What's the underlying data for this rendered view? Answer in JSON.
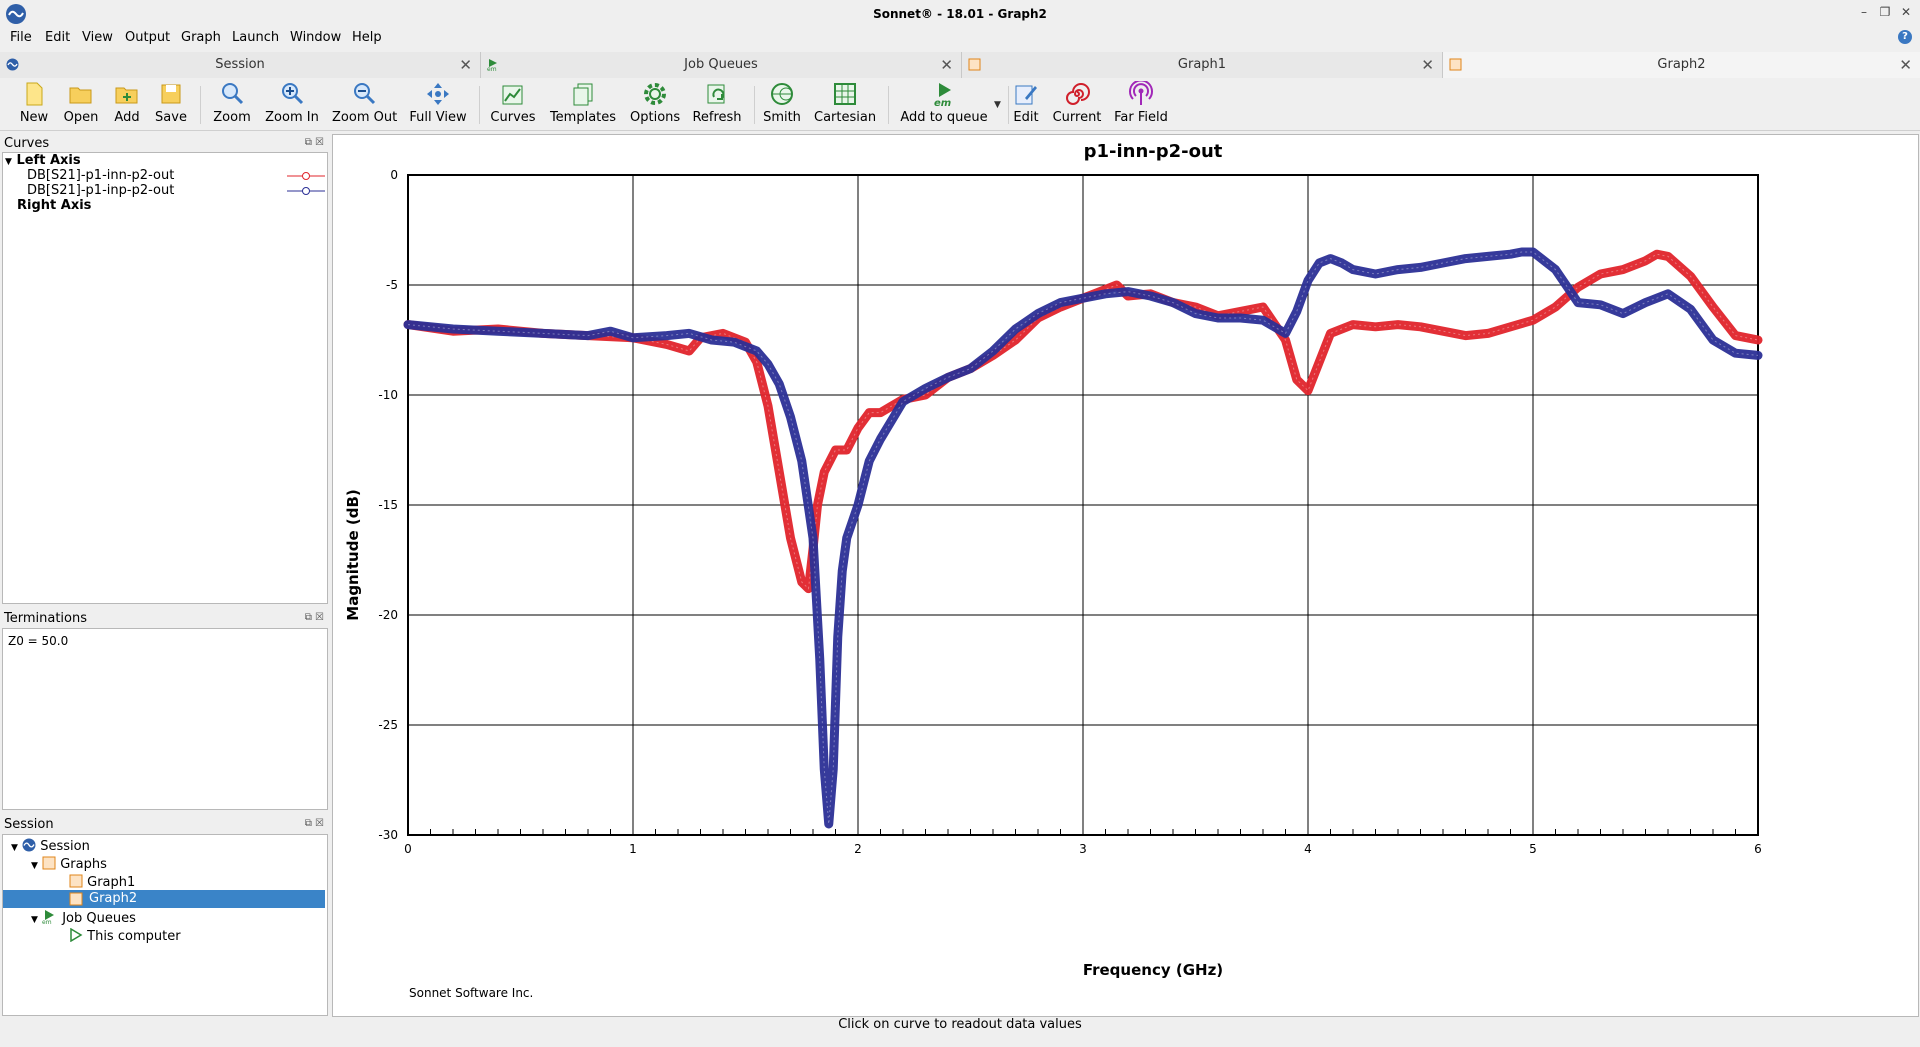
{
  "window": {
    "title": "Sonnet® - 18.01 - Graph2"
  },
  "menu": [
    "File",
    "Edit",
    "View",
    "Output",
    "Graph",
    "Launch",
    "Window",
    "Help"
  ],
  "tabs": [
    {
      "label": "Session",
      "active": false
    },
    {
      "label": "Job Queues",
      "active": false
    },
    {
      "label": "Graph1",
      "active": false
    },
    {
      "label": "Graph2",
      "active": true
    }
  ],
  "toolbar": {
    "new": "New",
    "open": "Open",
    "add": "Add",
    "save": "Save",
    "zoom": "Zoom",
    "zoom_in": "Zoom In",
    "zoom_out": "Zoom Out",
    "full_view": "Full View",
    "curves": "Curves",
    "templates": "Templates",
    "options": "Options",
    "refresh": "Refresh",
    "smith": "Smith",
    "cartesian": "Cartesian",
    "add_to_queue": "Add to queue",
    "edit": "Edit",
    "current": "Current",
    "far_field": "Far Field",
    "em_label": "em"
  },
  "curves_panel": {
    "title": "Curves",
    "left_axis": "Left Axis",
    "right_axis": "Right Axis",
    "items": [
      {
        "label": "DB[S21]-p1-inn-p2-out",
        "color": "#e0242b"
      },
      {
        "label": "DB[S21]-p1-inp-p2-out",
        "color": "#2b2f96"
      }
    ]
  },
  "terminations_panel": {
    "title": "Terminations",
    "text": "Z0 = 50.0"
  },
  "session_panel": {
    "title": "Session",
    "root": "Session",
    "graphs": "Graphs",
    "graph1": "Graph1",
    "graph2": "Graph2",
    "job_queues": "Job Queues",
    "computer": "This computer",
    "em_label": "em"
  },
  "status": {
    "text": "Click on curve to readout data values"
  },
  "footer": {
    "company": "Sonnet Software Inc."
  },
  "chart_data": {
    "type": "line",
    "title": "p1-inn-p2-out",
    "xlabel": "Frequency (GHz)",
    "ylabel": "Magnitude (dB)",
    "xlim": [
      0,
      6
    ],
    "ylim": [
      -30,
      0
    ],
    "xticks": [
      0,
      1,
      2,
      3,
      4,
      5,
      6
    ],
    "yticks": [
      0,
      -5,
      -10,
      -15,
      -20,
      -25,
      -30
    ],
    "grid": true,
    "series": [
      {
        "name": "DB[S21]-p1-inn-p2-out",
        "color": "#e0242b",
        "x": [
          0,
          0.2,
          0.4,
          0.6,
          0.8,
          1.0,
          1.15,
          1.25,
          1.3,
          1.4,
          1.5,
          1.55,
          1.6,
          1.65,
          1.7,
          1.75,
          1.78,
          1.8,
          1.82,
          1.85,
          1.9,
          1.95,
          2.0,
          2.05,
          2.1,
          2.2,
          2.3,
          2.4,
          2.5,
          2.6,
          2.7,
          2.8,
          2.9,
          3.0,
          3.1,
          3.15,
          3.2,
          3.3,
          3.4,
          3.5,
          3.6,
          3.7,
          3.8,
          3.9,
          3.95,
          4.0,
          4.05,
          4.1,
          4.2,
          4.3,
          4.4,
          4.5,
          4.6,
          4.7,
          4.8,
          4.9,
          5.0,
          5.1,
          5.2,
          5.3,
          5.4,
          5.5,
          5.55,
          5.6,
          5.7,
          5.8,
          5.9,
          6.0
        ],
        "y": [
          -6.8,
          -7.1,
          -7.0,
          -7.2,
          -7.3,
          -7.4,
          -7.7,
          -8.0,
          -7.4,
          -7.2,
          -7.6,
          -8.5,
          -10.5,
          -13.5,
          -16.5,
          -18.5,
          -18.8,
          -17.0,
          -15.0,
          -13.5,
          -12.5,
          -12.5,
          -11.5,
          -10.8,
          -10.8,
          -10.2,
          -10.0,
          -9.2,
          -8.8,
          -8.2,
          -7.5,
          -6.5,
          -6.0,
          -5.6,
          -5.2,
          -5.0,
          -5.5,
          -5.4,
          -5.8,
          -6.0,
          -6.4,
          -6.2,
          -6.0,
          -7.5,
          -9.3,
          -9.8,
          -8.5,
          -7.2,
          -6.8,
          -6.9,
          -6.8,
          -6.9,
          -7.1,
          -7.3,
          -7.2,
          -6.9,
          -6.6,
          -6.0,
          -5.1,
          -4.5,
          -4.3,
          -3.9,
          -3.6,
          -3.7,
          -4.6,
          -6.0,
          -7.3,
          -7.5
        ]
      },
      {
        "name": "DB[S21]-p1-inp-p2-out",
        "color": "#2b2f96",
        "x": [
          0,
          0.2,
          0.4,
          0.6,
          0.8,
          0.9,
          1.0,
          1.15,
          1.25,
          1.35,
          1.45,
          1.55,
          1.6,
          1.65,
          1.7,
          1.75,
          1.8,
          1.83,
          1.85,
          1.87,
          1.89,
          1.91,
          1.93,
          1.95,
          2.0,
          2.05,
          2.1,
          2.2,
          2.3,
          2.4,
          2.5,
          2.6,
          2.7,
          2.8,
          2.9,
          3.0,
          3.1,
          3.2,
          3.3,
          3.4,
          3.5,
          3.6,
          3.7,
          3.8,
          3.9,
          3.95,
          4.0,
          4.05,
          4.1,
          4.15,
          4.2,
          4.3,
          4.4,
          4.5,
          4.6,
          4.7,
          4.8,
          4.9,
          4.95,
          5.0,
          5.1,
          5.2,
          5.3,
          5.4,
          5.5,
          5.6,
          5.7,
          5.8,
          5.9,
          6.0
        ],
        "y": [
          -6.8,
          -7.0,
          -7.1,
          -7.2,
          -7.3,
          -7.1,
          -7.4,
          -7.3,
          -7.2,
          -7.5,
          -7.6,
          -8.0,
          -8.6,
          -9.5,
          -11.0,
          -13.0,
          -16.5,
          -22.0,
          -27.0,
          -29.5,
          -27.0,
          -21.0,
          -18.0,
          -16.5,
          -15.0,
          -13.0,
          -12.0,
          -10.3,
          -9.7,
          -9.2,
          -8.8,
          -8.0,
          -7.0,
          -6.3,
          -5.8,
          -5.6,
          -5.4,
          -5.3,
          -5.5,
          -5.8,
          -6.3,
          -6.5,
          -6.5,
          -6.6,
          -7.2,
          -6.2,
          -4.8,
          -4.0,
          -3.8,
          -4.0,
          -4.3,
          -4.5,
          -4.3,
          -4.2,
          -4.0,
          -3.8,
          -3.7,
          -3.6,
          -3.5,
          -3.5,
          -4.3,
          -5.8,
          -5.9,
          -6.3,
          -5.8,
          -5.4,
          -6.1,
          -7.5,
          -8.1,
          -8.2
        ]
      }
    ]
  }
}
